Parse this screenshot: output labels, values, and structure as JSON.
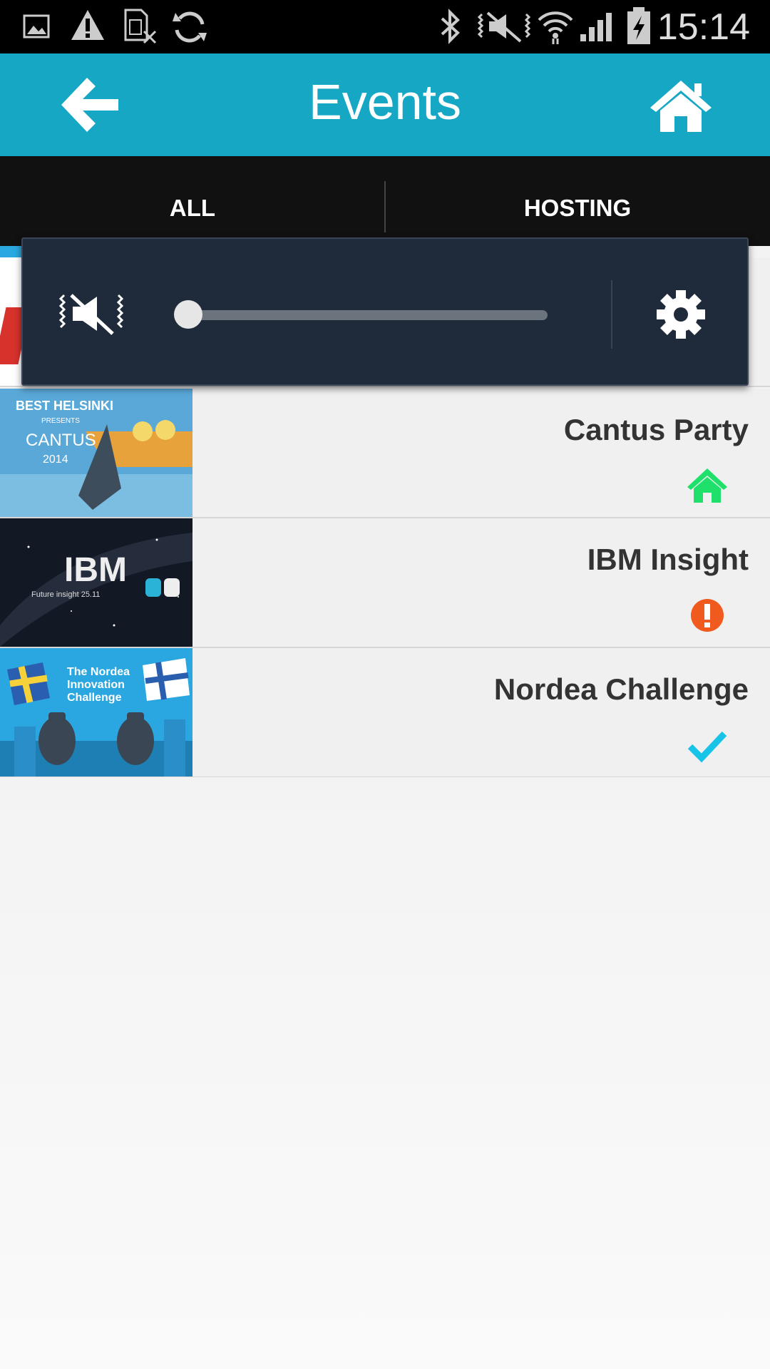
{
  "status_bar": {
    "time": "15:14",
    "icons": [
      "image-icon",
      "warning-icon",
      "sim-blocked-icon",
      "sync-icon",
      "bluetooth-icon",
      "vibrate-mute-icon",
      "wifi-icon",
      "signal-icon",
      "battery-charging-icon"
    ]
  },
  "app_bar": {
    "title": "Events",
    "back_icon": "back-arrow-icon",
    "home_icon": "home-icon",
    "color": "#15a7c4"
  },
  "tabs": [
    {
      "label": "ALL",
      "selected": true
    },
    {
      "label": "HOSTING",
      "selected": false
    }
  ],
  "events": [
    {
      "title": "Cantus Party",
      "status_icon": "home-icon",
      "status_color": "#1ee06a",
      "thumbnail_text": [
        "BEST HELSINKI",
        "PRESENTS",
        "CANTUS",
        "2014"
      ]
    },
    {
      "title": "IBM Insight",
      "status_icon": "alert-icon",
      "status_color": "#f05a1e",
      "thumbnail_text": [
        "IBM",
        "Future insight 25.11"
      ]
    },
    {
      "title": "Nordea Challenge",
      "status_icon": "checkmark-icon",
      "status_color": "#17c4e8",
      "thumbnail_text": [
        "The Nordea",
        "Innovation",
        "Challenge"
      ]
    }
  ],
  "volume_panel": {
    "mode_icon": "vibrate-mute-icon",
    "level": 0,
    "settings_icon": "gear-icon"
  }
}
